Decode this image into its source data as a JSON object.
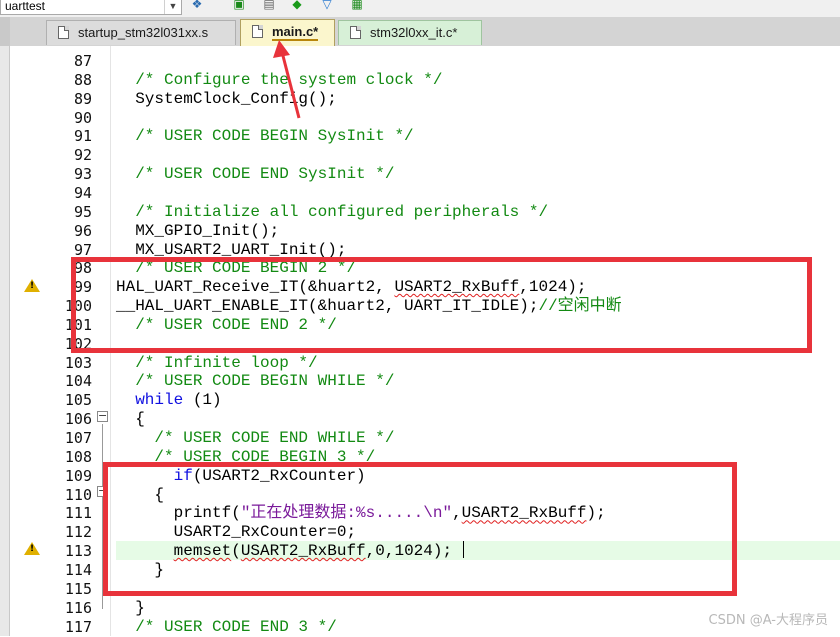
{
  "toolbar": {
    "target_name": "uarttest",
    "icons": [
      "target-options-icon",
      "manage-components-icon",
      "build-icon",
      "download-icon",
      "debug-icon",
      "settings-icon"
    ]
  },
  "tabs": [
    {
      "label": "startup_stm32l031xx.s",
      "active": false,
      "color": "#dcdcdc"
    },
    {
      "label": "main.c*",
      "active": true,
      "color": "#fbf6cd"
    },
    {
      "label": "stm32l0xx_it.c*",
      "active": false,
      "color": "#d7f0d7"
    }
  ],
  "lines": [
    {
      "n": "87",
      "code": ""
    },
    {
      "n": "88",
      "code": "  /* Configure the system clock */"
    },
    {
      "n": "89",
      "code": "  SystemClock_Config();"
    },
    {
      "n": "90",
      "code": ""
    },
    {
      "n": "91",
      "code": "  /* USER CODE BEGIN SysInit */"
    },
    {
      "n": "92",
      "code": ""
    },
    {
      "n": "93",
      "code": "  /* USER CODE END SysInit */"
    },
    {
      "n": "94",
      "code": ""
    },
    {
      "n": "95",
      "code": "  /* Initialize all configured peripherals */"
    },
    {
      "n": "96",
      "code": "  MX_GPIO_Init();"
    },
    {
      "n": "97",
      "code": "  MX_USART2_UART_Init();"
    },
    {
      "n": "98",
      "code": "  /* USER CODE BEGIN 2 */"
    },
    {
      "n": "99",
      "code": "HAL_UART_Receive_IT(&huart2, USART2_RxBuff,1024);"
    },
    {
      "n": "100",
      "code": "__HAL_UART_ENABLE_IT(&huart2, UART_IT_IDLE);//空闲中断"
    },
    {
      "n": "101",
      "code": "  /* USER CODE END 2 */"
    },
    {
      "n": "102",
      "code": ""
    },
    {
      "n": "103",
      "code": "  /* Infinite loop */"
    },
    {
      "n": "104",
      "code": "  /* USER CODE BEGIN WHILE */"
    },
    {
      "n": "105",
      "code": "  while (1)"
    },
    {
      "n": "106",
      "code": "  {"
    },
    {
      "n": "107",
      "code": "    /* USER CODE END WHILE */"
    },
    {
      "n": "108",
      "code": "    /* USER CODE BEGIN 3 */"
    },
    {
      "n": "109",
      "code": "      if(USART2_RxCounter)"
    },
    {
      "n": "110",
      "code": "    {"
    },
    {
      "n": "111",
      "code": "      printf(\"正在处理数据:%s.....\\n\",USART2_RxBuff);"
    },
    {
      "n": "112",
      "code": "      USART2_RxCounter=0;"
    },
    {
      "n": "113",
      "code": "      memset(USART2_RxBuff,0,1024);"
    },
    {
      "n": "114",
      "code": "    }"
    },
    {
      "n": "115",
      "code": ""
    },
    {
      "n": "116",
      "code": "  }"
    },
    {
      "n": "117",
      "code": "  /* USER CODE END 3 */"
    }
  ],
  "watermark": "CSDN @A-大程序员",
  "colors": {
    "comment": "#138a13",
    "keyword": "#1010e0",
    "string": "#7a1a9a",
    "annotation": "#e8333b",
    "current_line": "#e6fbe6"
  }
}
